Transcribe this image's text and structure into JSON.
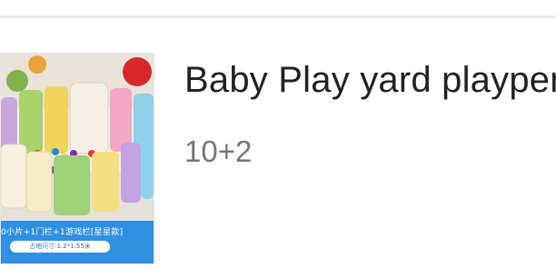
{
  "product": {
    "title": "Baby Play yard playpen",
    "subtitle": "10+2",
    "image": {
      "caption": "0小片+1门栏+1游戏栏[星星款]",
      "size_note": "占地尺寸:1.2*1.55米",
      "description": "baby-playpen-product-photo"
    }
  },
  "colors": {
    "title": "#222222",
    "subtitle": "#767676",
    "image_band": "#2f8fe0",
    "divider": "#ebebeb"
  }
}
